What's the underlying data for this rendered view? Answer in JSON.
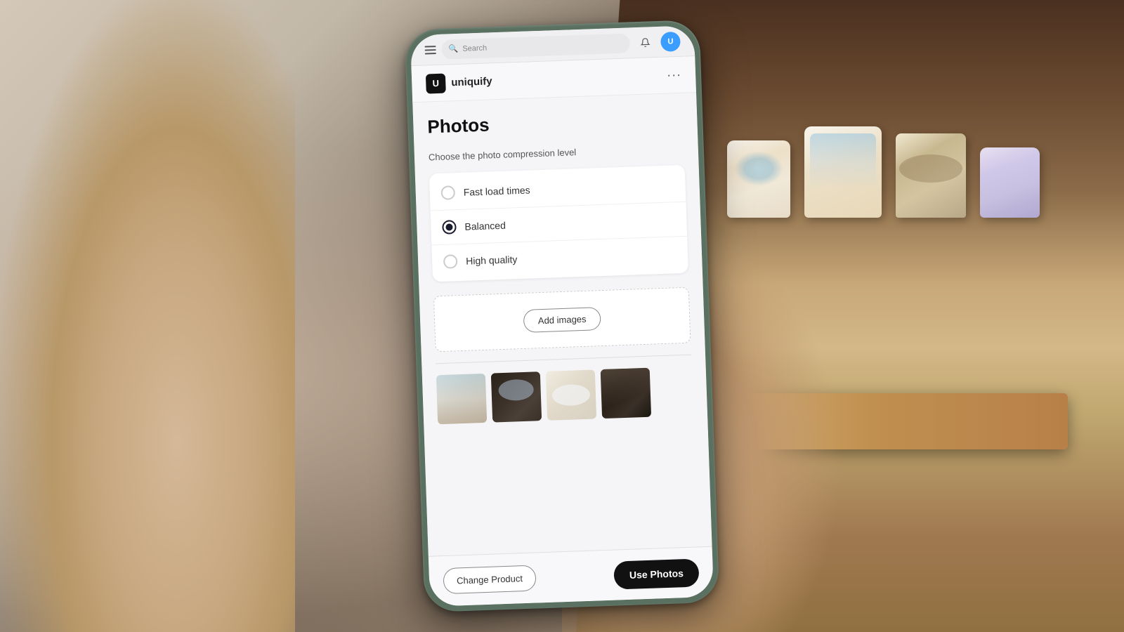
{
  "scene": {
    "background_description": "Hands holding phone, wooden shelf with soap bars in background"
  },
  "status_bar": {
    "search_placeholder": "Search",
    "notification_icon": "bell-icon",
    "profile_initial": "U"
  },
  "app_header": {
    "logo_symbol": "U",
    "app_name": "uniquify",
    "more_icon": "more-horizontal-icon"
  },
  "page": {
    "title": "Photos",
    "compression_label": "Choose the photo compression level",
    "radio_options": [
      {
        "id": "fast",
        "label": "Fast load times",
        "selected": false
      },
      {
        "id": "balanced",
        "label": "Balanced",
        "selected": true
      },
      {
        "id": "high",
        "label": "High quality",
        "selected": false
      }
    ],
    "add_images_label": "Add images",
    "thumbnails": [
      {
        "id": "thumb-1",
        "description": "Blue and white soap"
      },
      {
        "id": "thumb-2",
        "description": "Blue soap dark background"
      },
      {
        "id": "thumb-3",
        "description": "White soap on marble"
      },
      {
        "id": "thumb-4",
        "description": "Dark soap bar"
      }
    ]
  },
  "bottom_bar": {
    "change_product_label": "Change Product",
    "use_photos_label": "Use Photos"
  }
}
